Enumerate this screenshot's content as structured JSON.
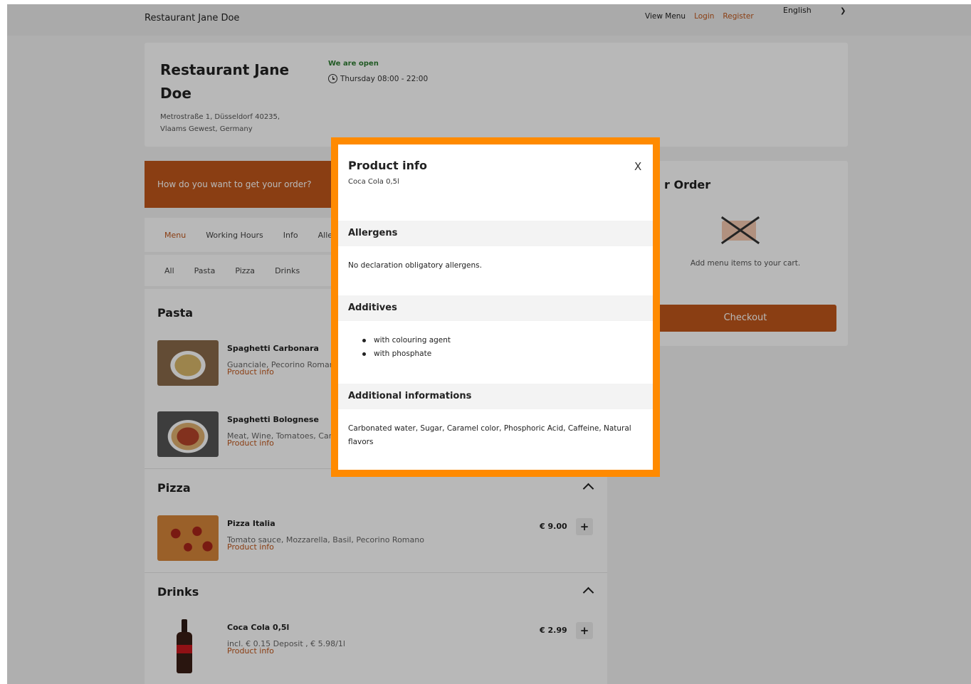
{
  "topbar": {
    "brand": "Restaurant Jane Doe",
    "view_menu": "View Menu",
    "login": "Login",
    "register": "Register",
    "language": "English"
  },
  "restaurant": {
    "name": "Restaurant Jane Doe",
    "address": "Metrostraße 1, Düsseldorf 40235, Vlaams Gewest, Germany",
    "open_status": "We are open",
    "hours": "Thursday 08:00 - 22:00"
  },
  "order_prompt": "How do you want to get your order?",
  "tabs": [
    "Menu",
    "Working Hours",
    "Info",
    "Alle"
  ],
  "categories": [
    "All",
    "Pasta",
    "Pizza",
    "Drinks"
  ],
  "menu": {
    "pasta": {
      "title": "Pasta",
      "items": [
        {
          "name": "Spaghetti Carbonara",
          "desc": "Guanciale, Pecorino Romano",
          "info": "Product info"
        },
        {
          "name": "Spaghetti Bolognese",
          "desc": "Meat, Wine, Tomatoes, Carr",
          "info": "Product info"
        }
      ]
    },
    "pizza": {
      "title": "Pizza",
      "items": [
        {
          "name": "Pizza Italia",
          "desc": "Tomato sauce, Mozzarella, Basil, Pecorino Romano",
          "info": "Product info",
          "price": "€ 9.00",
          "add": "+"
        }
      ]
    },
    "drinks": {
      "title": "Drinks",
      "items": [
        {
          "name": "Coca Cola 0,5l",
          "desc": "incl. € 0.15 Deposit , € 5.98/1l",
          "info": "Product info",
          "price": "€ 2.99",
          "add": "+"
        }
      ]
    }
  },
  "cart": {
    "title": "r Order",
    "empty_text": "Add menu items to your cart.",
    "checkout": "Checkout"
  },
  "modal": {
    "title": "Product info",
    "product": "Coca Cola 0,5l",
    "close": "X",
    "allergens_title": "Allergens",
    "allergens_text": "No declaration obligatory allergens.",
    "additives_title": "Additives",
    "additives": [
      "with colouring agent",
      "with phosphate"
    ],
    "additional_title": "Additional informations",
    "additional_text": "Carbonated water, Sugar, Caramel color, Phosphoric Acid, Caffeine, Natural flavors"
  },
  "colors": {
    "accent": "#c0571b",
    "highlight": "#ff8a00",
    "open": "#2e7d32"
  }
}
